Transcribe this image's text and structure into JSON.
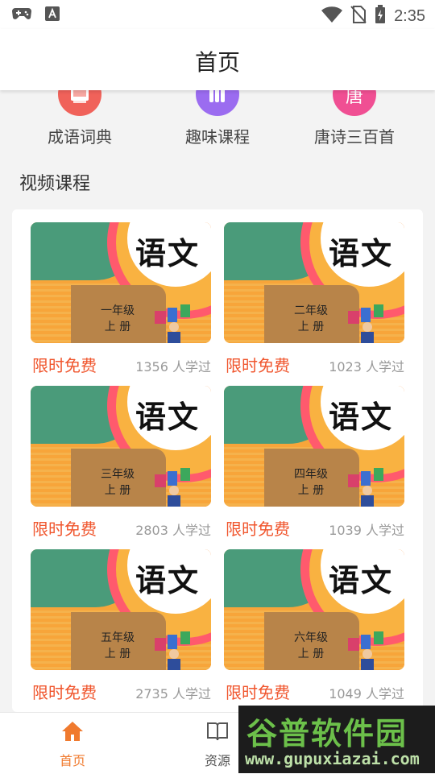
{
  "status": {
    "time": "2:35"
  },
  "header": {
    "title": "首页"
  },
  "categories": [
    {
      "label": "成语词典",
      "color": "#f0625a",
      "icon": "book-icon"
    },
    {
      "label": "趣味课程",
      "color": "#9b6cf0",
      "icon": "books-icon"
    },
    {
      "label": "唐诗三百首",
      "color": "#f04f93",
      "icon": "tang-icon",
      "glyph": "唐"
    }
  ],
  "section": {
    "title": "视频课程"
  },
  "courses": [
    {
      "cover_title": "语文",
      "grade": "一年级",
      "term": "上 册",
      "price_tag": "限时免费",
      "learners": "1356 人学过"
    },
    {
      "cover_title": "语文",
      "grade": "二年级",
      "term": "上 册",
      "price_tag": "限时免费",
      "learners": "1023 人学过"
    },
    {
      "cover_title": "语文",
      "grade": "三年级",
      "term": "上 册",
      "price_tag": "限时免费",
      "learners": "2803 人学过"
    },
    {
      "cover_title": "语文",
      "grade": "四年级",
      "term": "上 册",
      "price_tag": "限时免费",
      "learners": "1039 人学过"
    },
    {
      "cover_title": "语文",
      "grade": "五年级",
      "term": "上 册",
      "price_tag": "限时免费",
      "learners": "2735 人学过"
    },
    {
      "cover_title": "语文",
      "grade": "六年级",
      "term": "上 册",
      "price_tag": "限时免费",
      "learners": "1049 人学过"
    }
  ],
  "tabs": [
    {
      "label": "首页",
      "icon": "home-icon",
      "active": true
    },
    {
      "label": "资源",
      "icon": "open-book-icon",
      "active": false
    }
  ],
  "colors": {
    "accent": "#f0562e",
    "active_tab": "#f07a2e",
    "inactive_tab": "#555555"
  },
  "watermark": {
    "title": "谷普软件园",
    "url": "www.gupuxiazai.com"
  }
}
